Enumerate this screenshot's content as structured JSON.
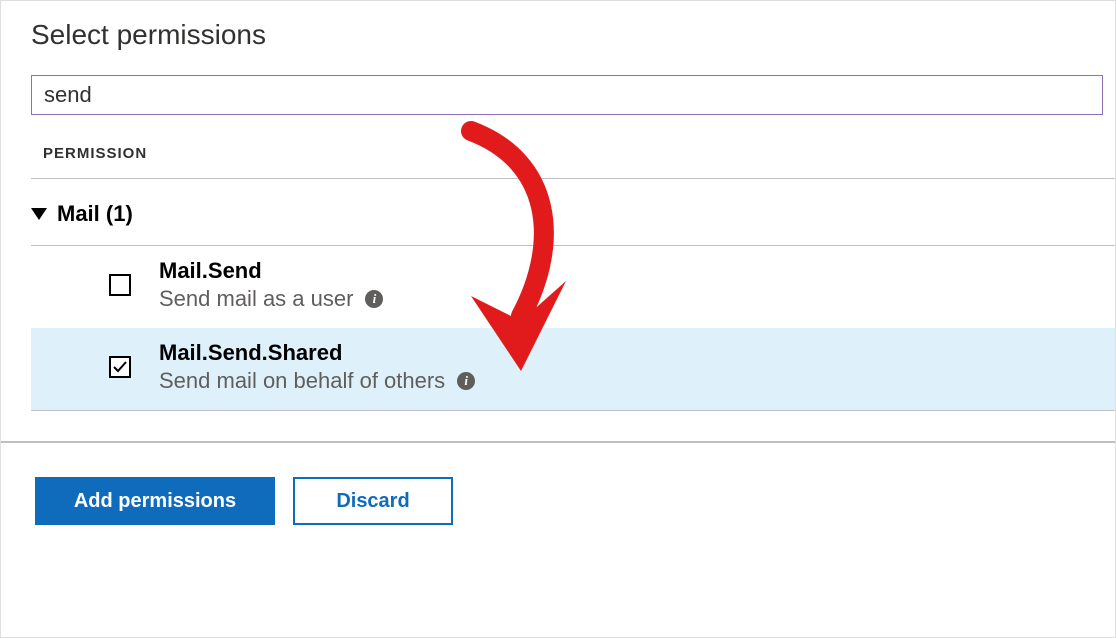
{
  "title": "Select permissions",
  "search": {
    "value": "send"
  },
  "column_header": "PERMISSION",
  "group": {
    "label": "Mail (1)"
  },
  "permissions": [
    {
      "name": "Mail.Send",
      "description": "Send mail as a user",
      "checked": false
    },
    {
      "name": "Mail.Send.Shared",
      "description": "Send mail on behalf of others",
      "checked": true
    }
  ],
  "buttons": {
    "primary": "Add permissions",
    "secondary": "Discard"
  },
  "annotation": {
    "color": "#e11b1b"
  }
}
